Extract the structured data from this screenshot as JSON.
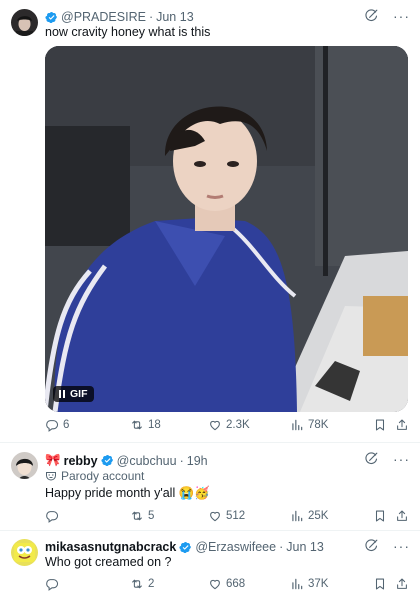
{
  "colors": {
    "accent": "#1d9bf0",
    "muted": "#536471",
    "text": "#0f1419",
    "jacket": "#2f3f9a"
  },
  "tweets": [
    {
      "author_name": "",
      "handle": "@PRADESIRE",
      "sep": "·",
      "date": "Jun 13",
      "verified": true,
      "text": "now cravity honey what is this",
      "media": {
        "badge": "GIF",
        "icon": "pause-icon"
      },
      "stats": {
        "replies": "6",
        "retweets": "18",
        "likes": "2.3K",
        "views": "78K"
      }
    },
    {
      "author_name": "rebby",
      "name_emoji": "🎀",
      "handle": "@cubchuu",
      "sep": "·",
      "date": "19h",
      "verified": true,
      "parody": "Parody account",
      "text": "Happy pride month y'all 😭🥳",
      "stats": {
        "replies": "",
        "retweets": "5",
        "likes": "512",
        "views": "25K"
      }
    },
    {
      "author_name": "mikasasnutgnabcrack",
      "handle": "@Erzaswifeee",
      "sep": "·",
      "date": "Jun 13",
      "verified": true,
      "text": "Who got creamed on ?",
      "stats": {
        "replies": "",
        "retweets": "2",
        "likes": "668",
        "views": "37K"
      }
    }
  ]
}
